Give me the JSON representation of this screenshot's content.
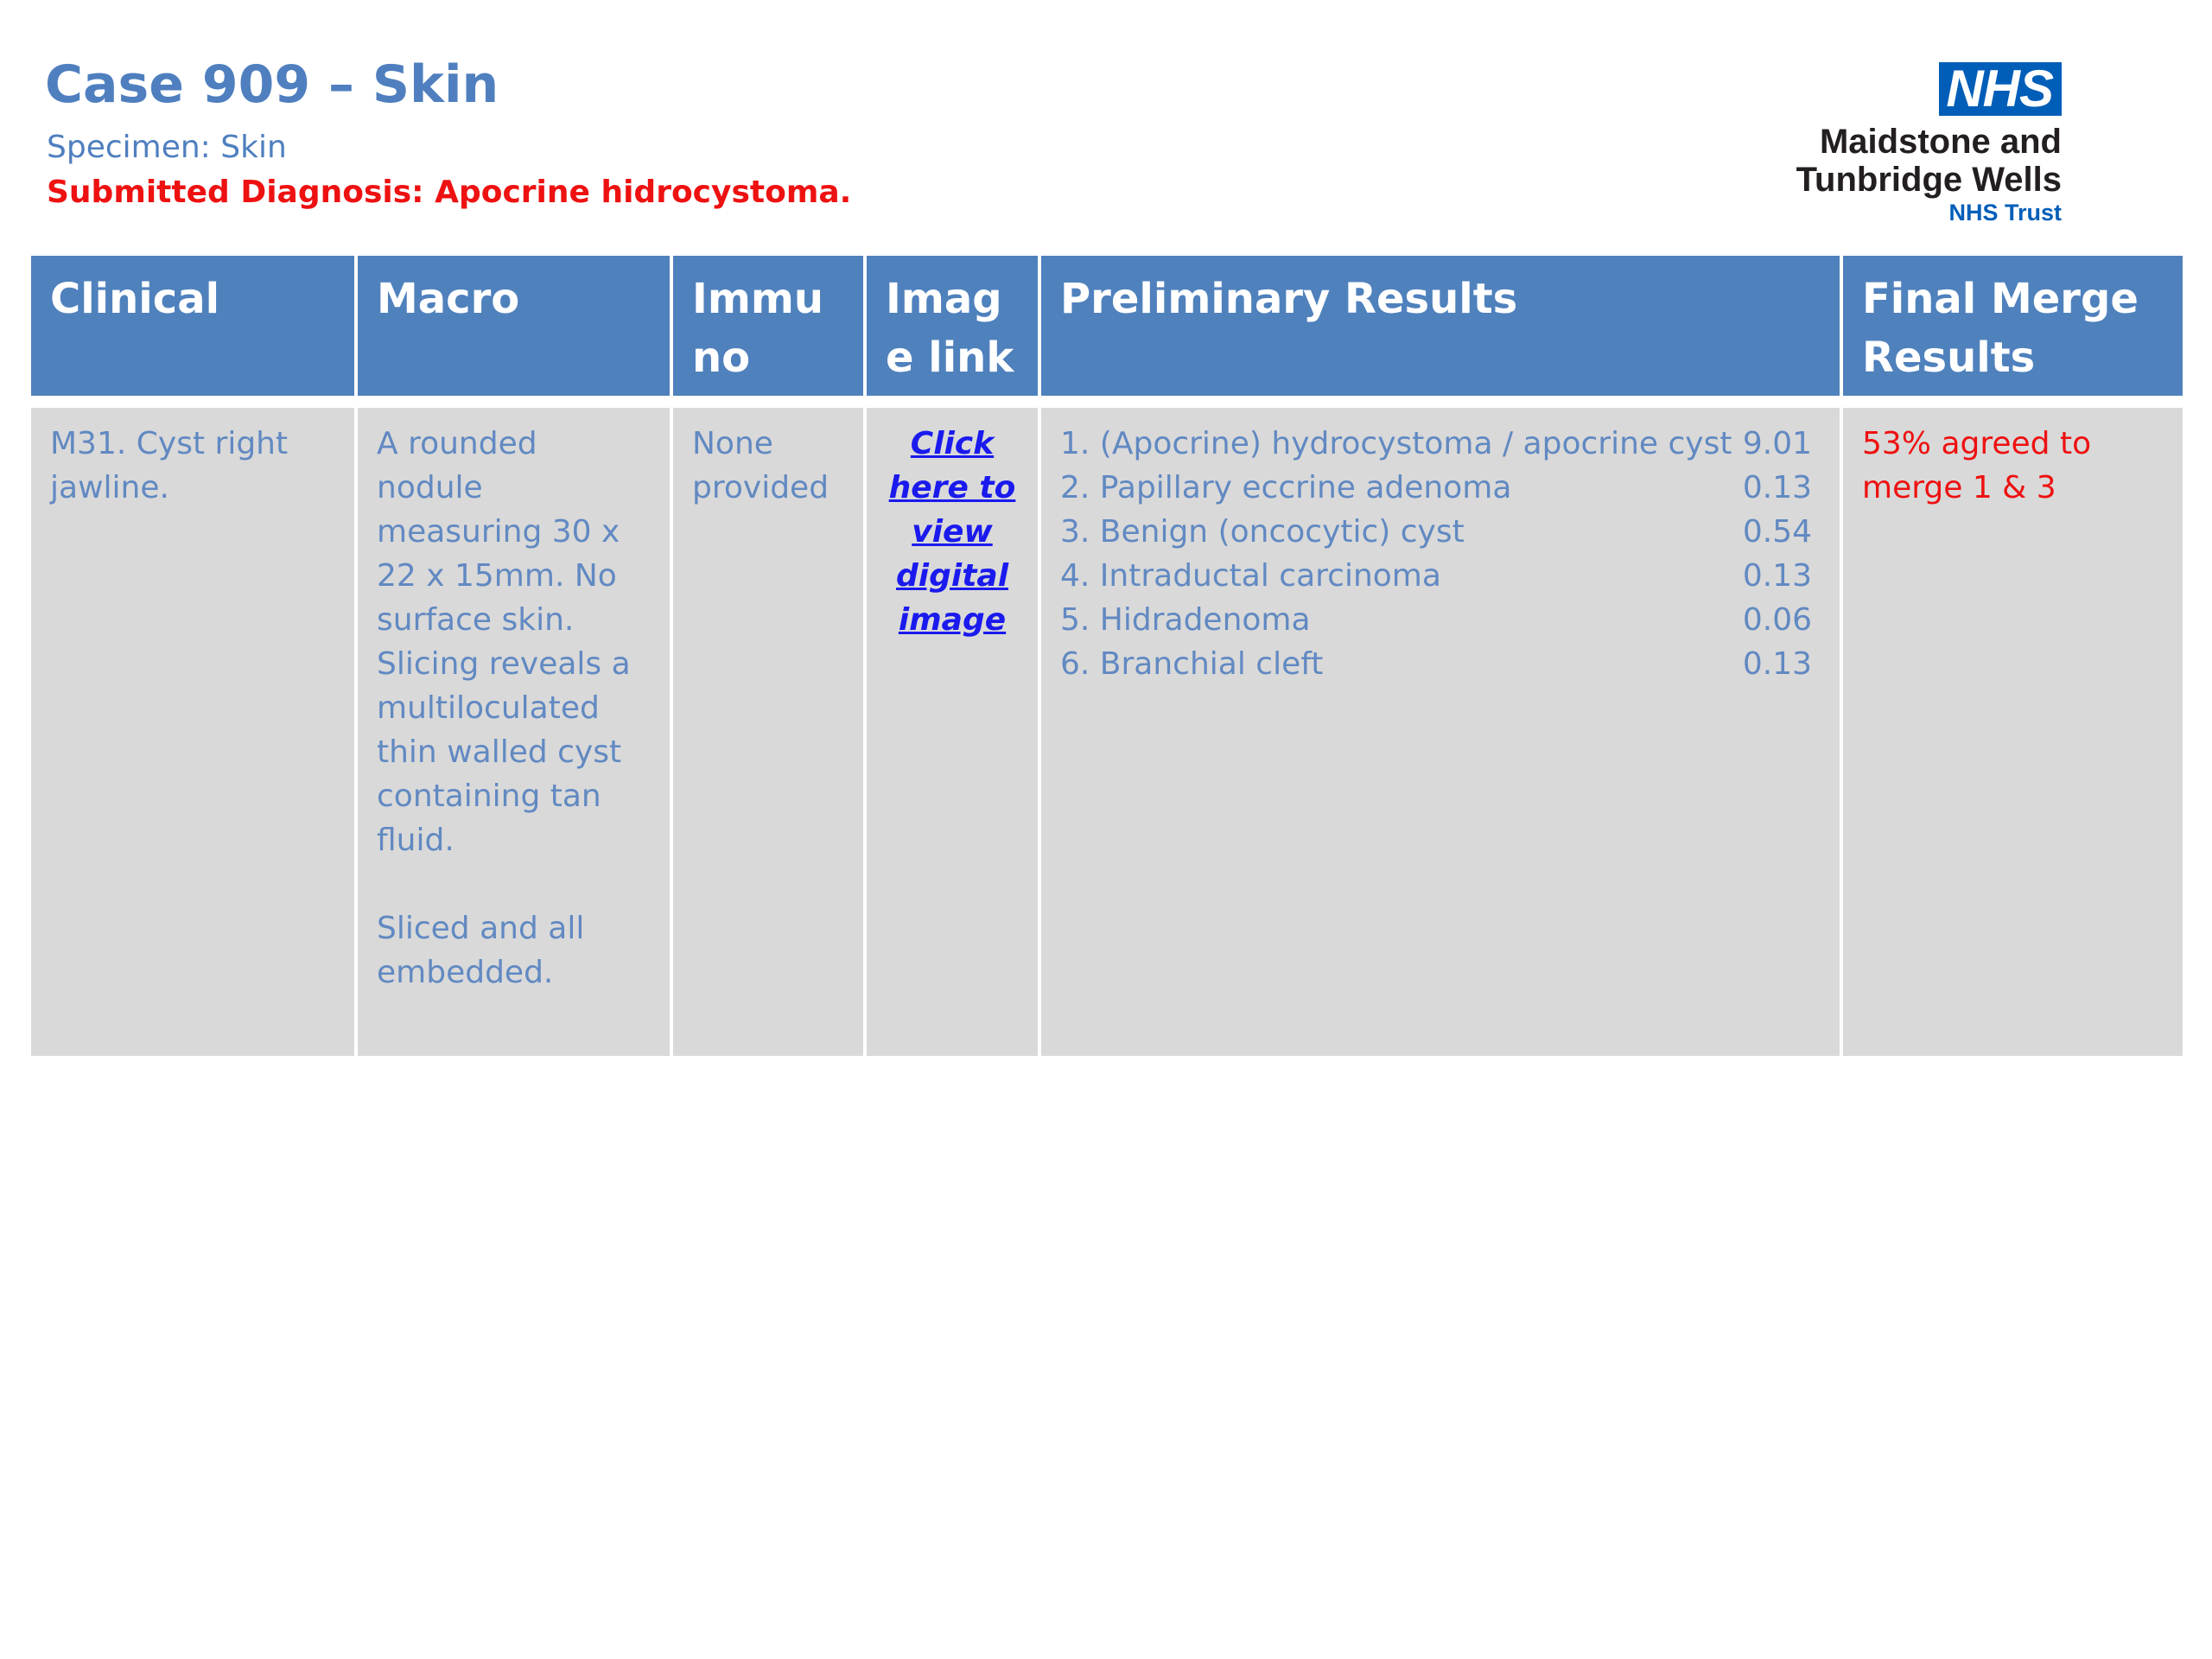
{
  "header": {
    "title": "Case 909 – Skin",
    "specimen": "Specimen: Skin",
    "submitted_diagnosis": "Submitted Diagnosis: Apocrine hidrocystoma."
  },
  "logo": {
    "badge": "NHS",
    "org_line1": "Maidstone and",
    "org_line2": "Tunbridge Wells",
    "trust": "NHS Trust",
    "color": "#005eb8"
  },
  "table": {
    "headers": {
      "clinical": "Clinical",
      "macro": "Macro",
      "immuno": "Immuno",
      "image_link": "Image link",
      "preliminary": "Preliminary Results",
      "final": "Final Merge Results"
    },
    "row": {
      "clinical": "M31. Cyst right jawline.",
      "macro": [
        "A rounded nodule measuring 30 x 22 x 15mm. No surface skin. Slicing reveals a multiloculated thin walled cyst containing tan fluid.",
        "Sliced and all embedded."
      ],
      "immuno": "None provided",
      "image_link": "Click here to view digital image",
      "results": [
        {
          "label": "1. (Apocrine) hydrocystoma / apocrine cyst",
          "score": "9.01"
        },
        {
          "label": "2. Papillary eccrine adenoma",
          "score": "0.13"
        },
        {
          "label": "3. Benign (oncocytic) cyst",
          "score": "0.54"
        },
        {
          "label": "4. Intraductal carcinoma",
          "score": "0.13"
        },
        {
          "label": "5. Hidradenoma",
          "score": "0.06"
        },
        {
          "label": "6. Branchial cleft",
          "score": "0.13"
        }
      ],
      "final": "53% agreed to merge 1 & 3"
    }
  },
  "colors": {
    "accent_blue": "#4f81bd",
    "cell_gray": "#d9d9d9",
    "alert_red": "#ee1111",
    "link_blue": "#1a1aee"
  }
}
